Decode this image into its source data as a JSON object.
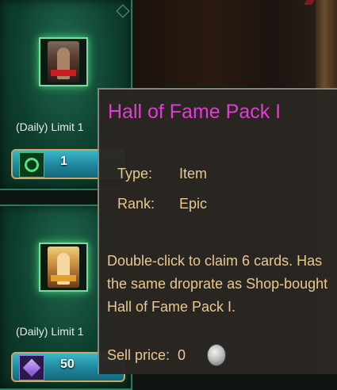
{
  "shop": {
    "items": [
      {
        "limit_label": "(Daily) Limit 1",
        "price": "1",
        "currency_icon": "green-token-icon"
      },
      {
        "limit_label": "(Daily) Limit 1",
        "price": "50",
        "currency_icon": "purple-gem-icon"
      }
    ]
  },
  "tooltip": {
    "title": "Hall of Fame Pack I",
    "title_color": "#e23bd8",
    "type_label": "Type:",
    "type_value": "Item",
    "rank_label": "Rank:",
    "rank_value": "Epic",
    "description": "Double-click to claim 6 cards. Has the same droprate as Shop-bought Hall of Fame Pack I.",
    "sell_label": "Sell price:",
    "sell_value": "0",
    "sell_currency_icon": "silver-coin-icon",
    "text_color": "#e8c890"
  }
}
